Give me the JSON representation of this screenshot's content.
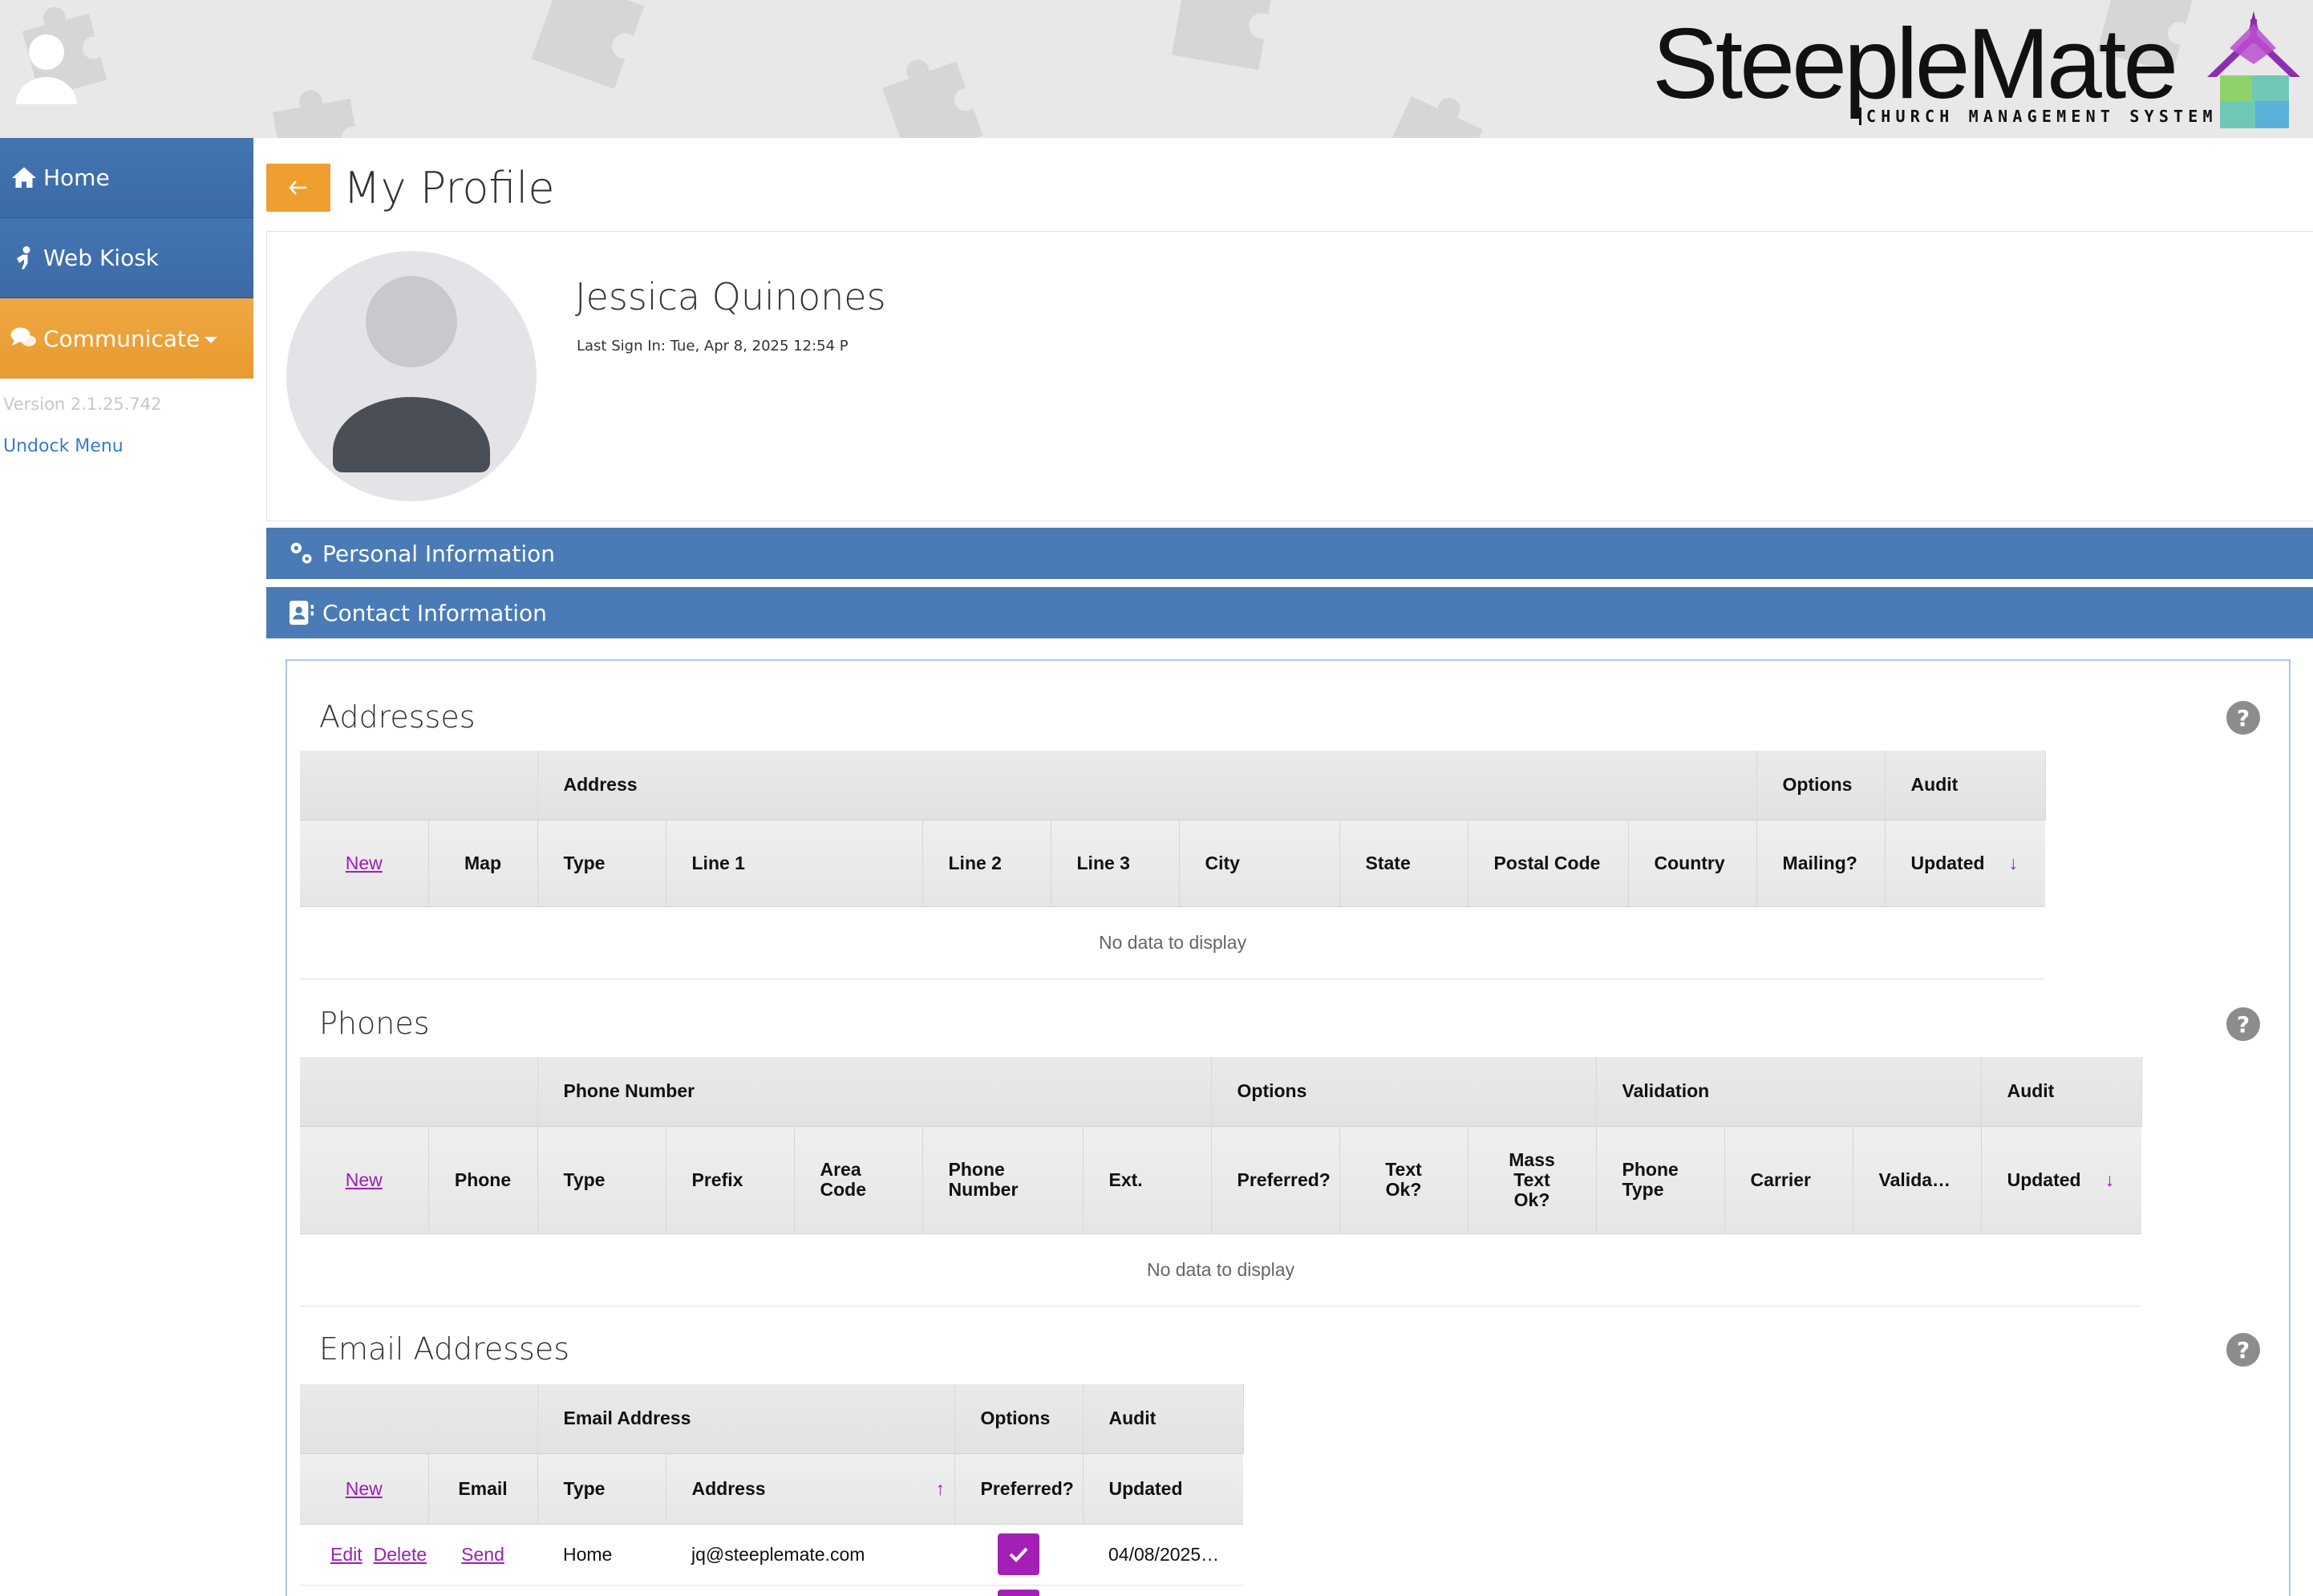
{
  "header": {
    "logo_text": "SteepleMate",
    "logo_subtitle": "CHURCH MANAGEMENT SYSTEM"
  },
  "sidebar": {
    "items": [
      {
        "label": "Home",
        "icon": "home-icon"
      },
      {
        "label": "Web Kiosk",
        "icon": "kiosk-icon"
      },
      {
        "label": "Communicate",
        "icon": "chat-bubbles-icon"
      }
    ],
    "version": "Version 2.1.25.742",
    "undock": "Undock Menu"
  },
  "page": {
    "title": "My Profile"
  },
  "profile": {
    "name": "Jessica Quinones",
    "last_sign_in": "Last Sign In: Tue, Apr 8, 2025 12:54 P"
  },
  "sections": {
    "personal": "Personal Information",
    "contact": "Contact Information"
  },
  "addresses": {
    "title": "Addresses",
    "bands": [
      "Address",
      "Options",
      "Audit"
    ],
    "new_label": "New",
    "columns": [
      "Map",
      "Type",
      "Line 1",
      "Line 2",
      "Line 3",
      "City",
      "State",
      "Postal Code",
      "Country",
      "Mailing?",
      "Updated"
    ],
    "empty": "No data to display"
  },
  "phones": {
    "title": "Phones",
    "bands": [
      "Phone Number",
      "Options",
      "Validation",
      "Audit"
    ],
    "new_label": "New",
    "columns": [
      "Phone",
      "Type",
      "Prefix",
      "Area Code",
      "Phone Number",
      "Ext.",
      "Preferred?",
      "Text Ok?",
      "Mass Text Ok?",
      "Phone Type",
      "Carrier",
      "Valida…",
      "Updated"
    ],
    "empty": "No data to display"
  },
  "emails": {
    "title": "Email Addresses",
    "bands": [
      "Email Address",
      "Options",
      "Audit"
    ],
    "new_label": "New",
    "columns": [
      "Email",
      "Type",
      "Address",
      "Preferred?",
      "Updated"
    ],
    "rows": [
      {
        "edit": "Edit",
        "delete": "Delete",
        "send": "Send",
        "type": "Home",
        "address": "jq@steeplemate.com",
        "preferred": true,
        "updated": "04/08/2025…"
      }
    ]
  },
  "colors": {
    "nav_blue": "#3c6aa7",
    "nav_orange": "#e79b30",
    "section_blue": "#4a7bb6",
    "accent_purple": "#a31fb5"
  }
}
